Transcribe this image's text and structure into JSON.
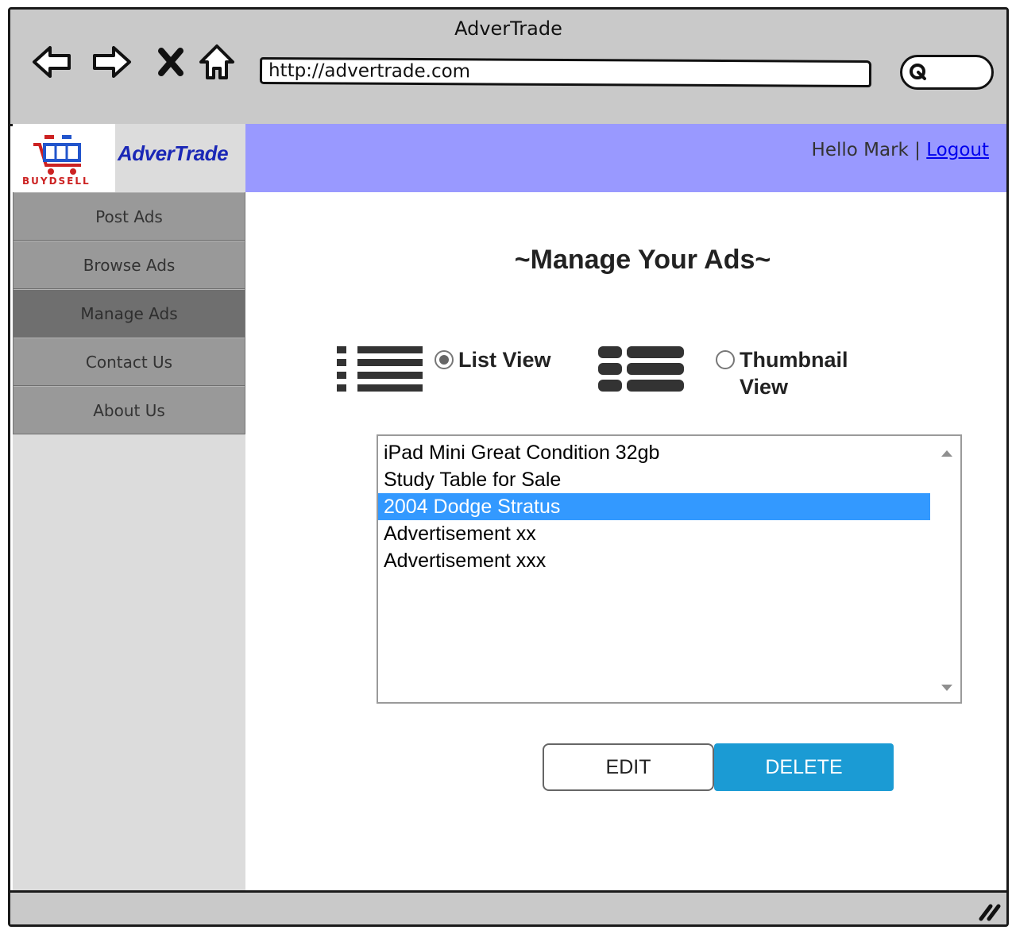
{
  "window": {
    "title": "AdverTrade"
  },
  "browser": {
    "url": "http://advertrade.com",
    "nav_icons": [
      "back-arrow-icon",
      "forward-arrow-icon",
      "stop-icon",
      "home-icon"
    ]
  },
  "header": {
    "logo_text": "BUYDSELL",
    "brand": "AdverTrade",
    "greeting": "Hello  Mark | ",
    "logout_label": "Logout",
    "bar_color": "#9999ff"
  },
  "sidebar": {
    "items": [
      {
        "label": "Post Ads"
      },
      {
        "label": "Browse Ads"
      },
      {
        "label": "Manage Ads",
        "active": true
      },
      {
        "label": "Contact Us"
      },
      {
        "label": "About Us"
      }
    ]
  },
  "main": {
    "title": "~Manage Your Ads~",
    "views": {
      "list_label": "List View",
      "thumbnail_label_line1": "Thumbnail",
      "thumbnail_label_line2": "View",
      "selected": "list"
    },
    "ads": [
      "iPad Mini Great Condition 32gb",
      "Study Table for Sale",
      "2004 Dodge Stratus",
      "Advertisement xx",
      "Advertisement xxx"
    ],
    "selected_ad": "2004 Dodge Stratus",
    "selection_color": "#3399ff",
    "edit_label": "EDIT",
    "delete_label": "DELETE",
    "delete_color": "#1b9bd4"
  }
}
